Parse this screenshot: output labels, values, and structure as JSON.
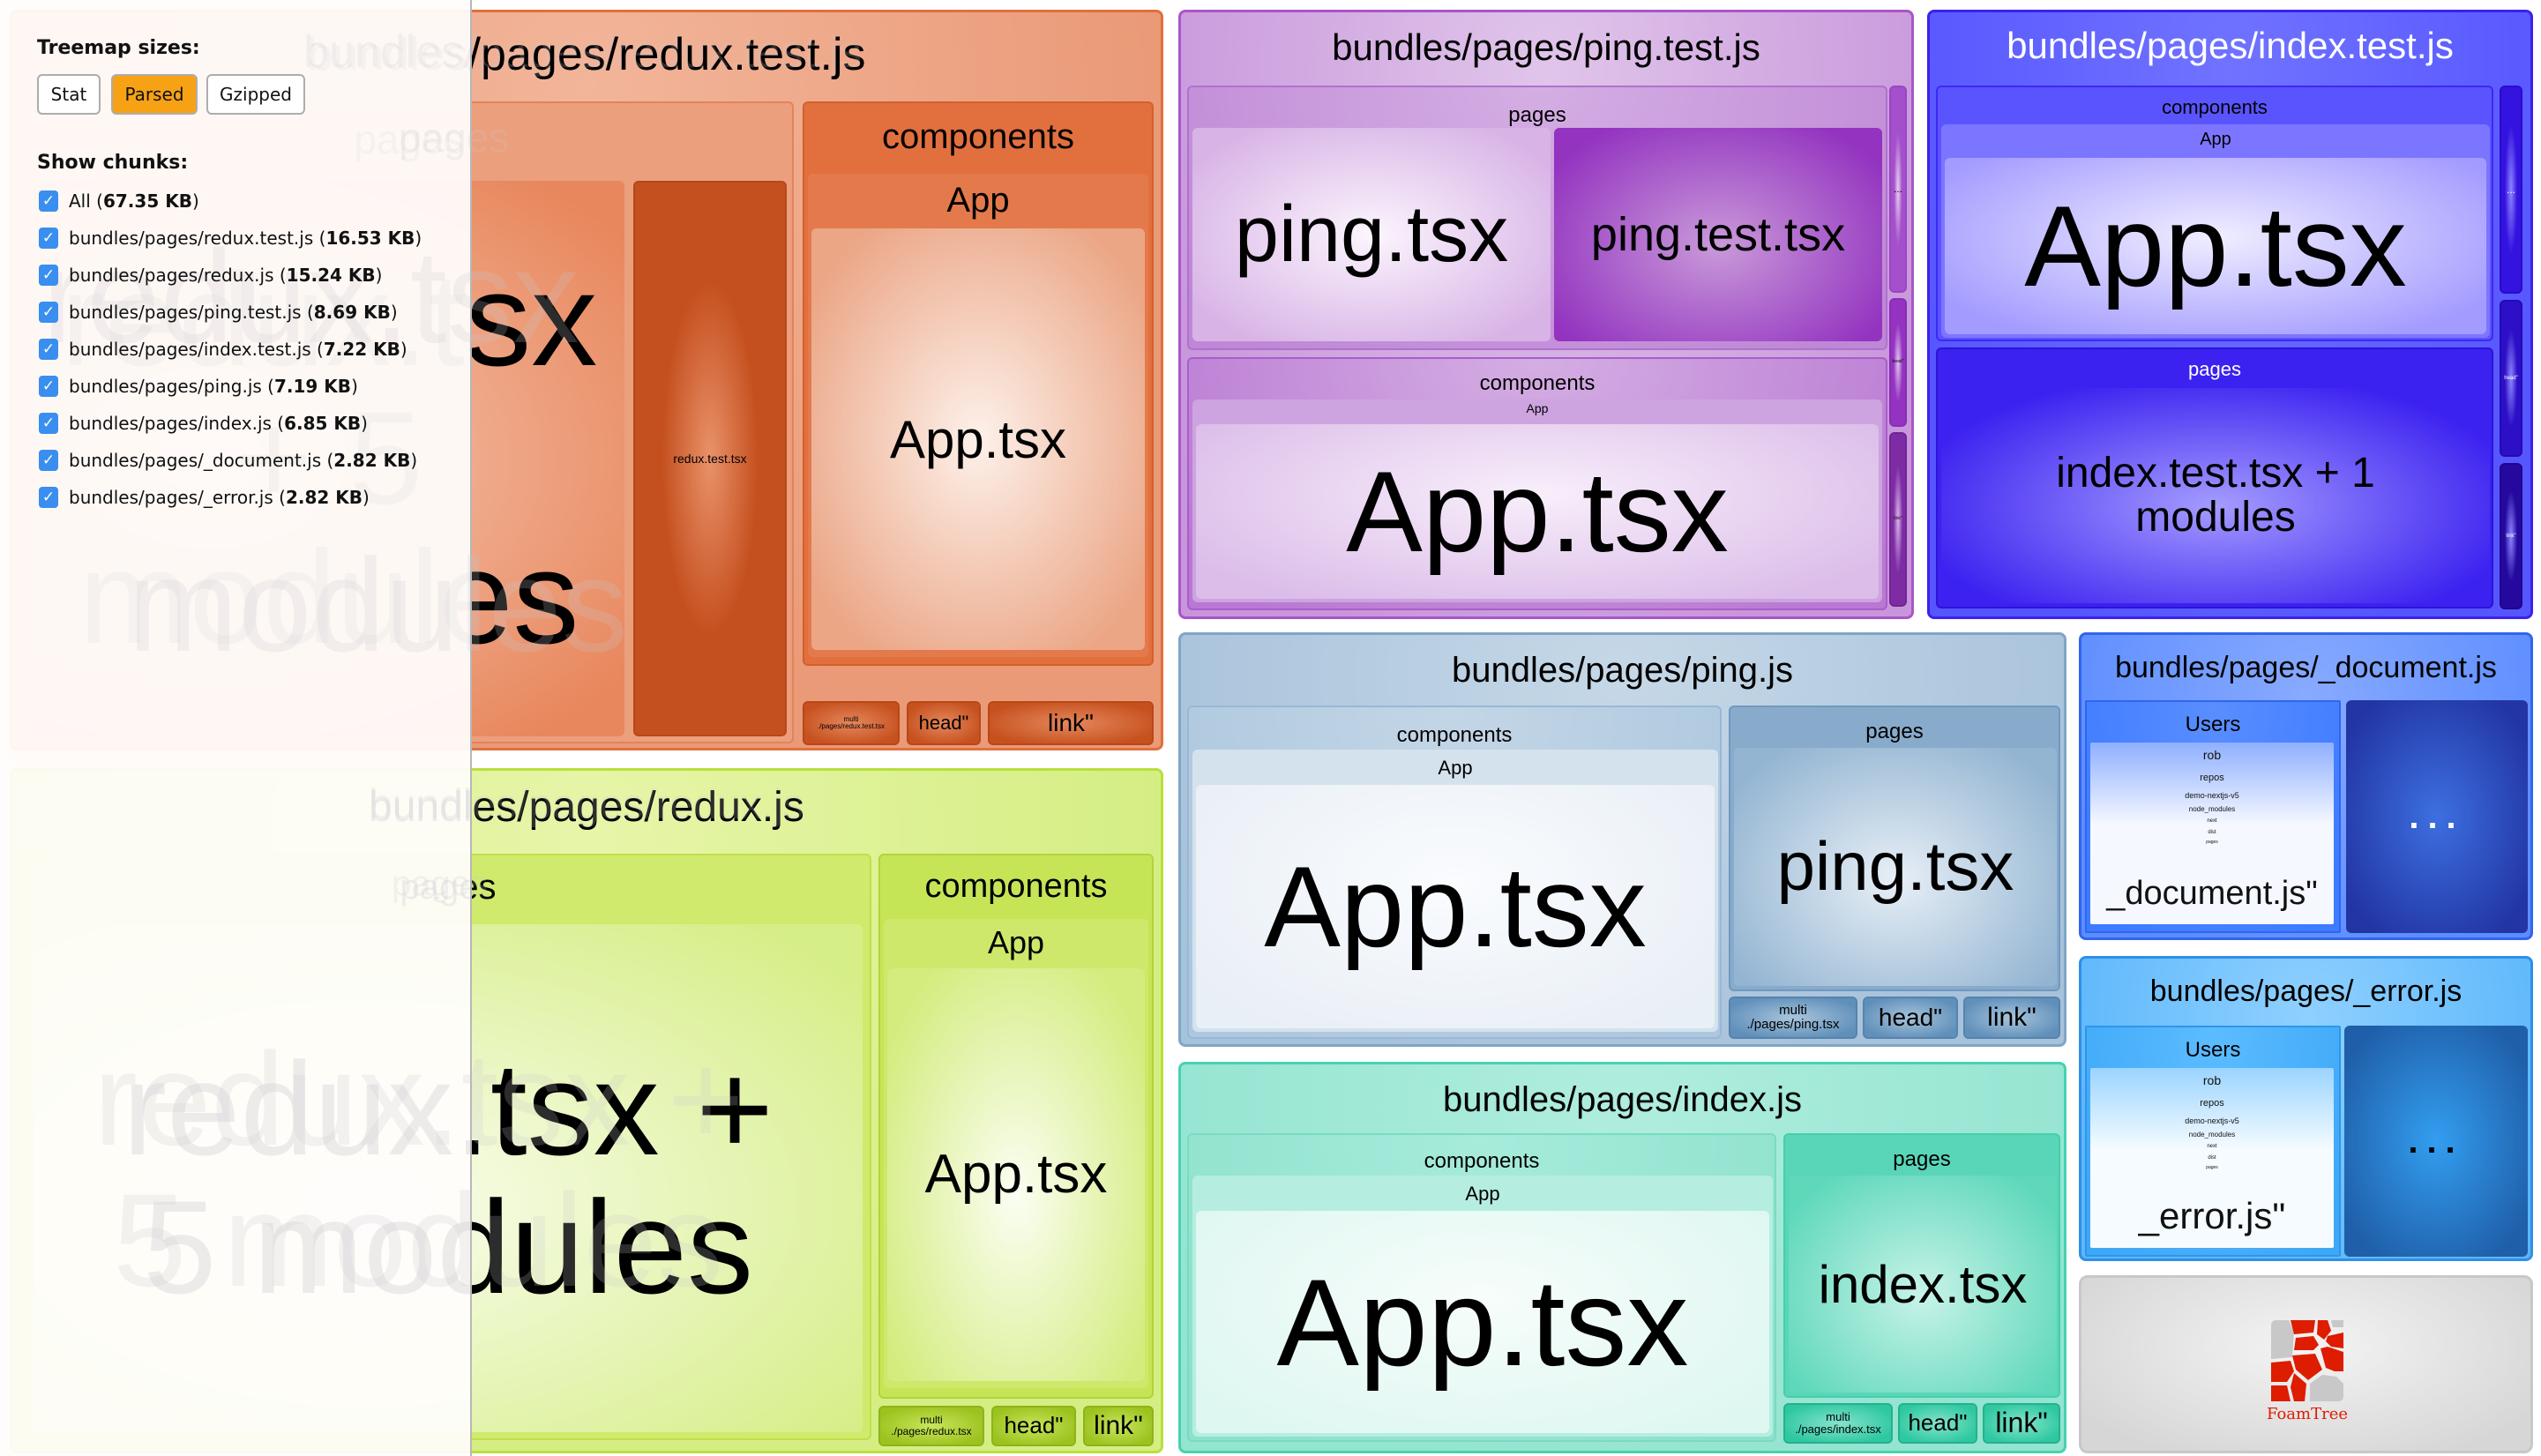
{
  "sidebar": {
    "treemap_sizes_label": "Treemap sizes:",
    "size_options": [
      {
        "label": "Stat",
        "active": false
      },
      {
        "label": "Parsed",
        "active": true
      },
      {
        "label": "Gzipped",
        "active": false
      }
    ],
    "show_chunks_label": "Show chunks:",
    "chunks": [
      {
        "name": "All",
        "size": "67.35 KB",
        "checked": true
      },
      {
        "name": "bundles/pages/redux.test.js",
        "size": "16.53 KB",
        "checked": true
      },
      {
        "name": "bundles/pages/redux.js",
        "size": "15.24 KB",
        "checked": true
      },
      {
        "name": "bundles/pages/ping.test.js",
        "size": "8.69 KB",
        "checked": true
      },
      {
        "name": "bundles/pages/index.test.js",
        "size": "7.22 KB",
        "checked": true
      },
      {
        "name": "bundles/pages/ping.js",
        "size": "7.19 KB",
        "checked": true
      },
      {
        "name": "bundles/pages/index.js",
        "size": "6.85 KB",
        "checked": true
      },
      {
        "name": "bundles/pages/_document.js",
        "size": "2.82 KB",
        "checked": true
      },
      {
        "name": "bundles/pages/_error.js",
        "size": "2.82 KB",
        "checked": true
      }
    ],
    "active_button_color": "#f7a215",
    "checkbox_color": "#3a8ef0"
  },
  "treemap": {
    "redux_test": {
      "title": "bundles/pages/redux.test.js",
      "pages_label": "pages",
      "main_line1": "redux.tsx",
      "main_line2": "+ 5",
      "main_line3": "modules",
      "dark_cell": "redux.test.tsx",
      "components_label": "components",
      "app_label": "App",
      "app_tsx": "App.tsx",
      "multi_line1": "multi",
      "multi_line2": "./pages/redux.test.tsx",
      "head": "head\"",
      "link": "link\"",
      "color": "#e0703e"
    },
    "redux": {
      "title": "bundles/pages/redux.js",
      "pages_label": "pages",
      "main_line1": "redux.tsx +",
      "main_line2": "5 modules",
      "components_label": "components",
      "app_label": "App",
      "app_tsx": "App.tsx",
      "multi_line1": "multi",
      "multi_line2": "./pages/redux.tsx",
      "head": "head\"",
      "link": "link\"",
      "color": "#b8e03b"
    },
    "ping_test": {
      "title": "bundles/pages/ping.test.js",
      "pages_label": "pages",
      "ping_tsx": "ping.tsx",
      "ping_test_tsx": "ping.test.tsx",
      "components_label": "components",
      "app_label": "App",
      "app_tsx": "App.tsx",
      "side_more": "...",
      "side_head": "head\"",
      "side_link": "link\"",
      "color": "#a955c9"
    },
    "index_test": {
      "title": "bundles/pages/index.test.js",
      "components_label": "components",
      "app_label": "App",
      "app_tsx": "App.tsx",
      "pages_label": "pages",
      "index_test_line1": "index.test.tsx + 1",
      "index_test_line2": "modules",
      "side_more": "...",
      "side_head": "head\"",
      "side_link": "link\"",
      "color": "#3a22ee"
    },
    "ping": {
      "title": "bundles/pages/ping.js",
      "components_label": "components",
      "app_label": "App",
      "app_tsx": "App.tsx",
      "pages_label": "pages",
      "ping_tsx": "ping.tsx",
      "multi_line1": "multi",
      "multi_line2": "./pages/ping.tsx",
      "head": "head\"",
      "link": "link\"",
      "color": "#7fa5c7"
    },
    "index": {
      "title": "bundles/pages/index.js",
      "components_label": "components",
      "app_label": "App",
      "app_tsx": "App.tsx",
      "pages_label": "pages",
      "index_tsx": "index.tsx",
      "multi_line1": "multi",
      "multi_line2": "./pages/index.tsx",
      "head": "head\"",
      "link": "link\"",
      "color": "#48d2b0"
    },
    "document": {
      "title": "bundles/pages/_document.js",
      "users_label": "Users",
      "tree": [
        "rob",
        "repos",
        "demo-nextjs-v5",
        "node_modules",
        "next",
        "dist",
        "pages"
      ],
      "file": "_document.js\"",
      "more": "...",
      "color": "#3065ee"
    },
    "error": {
      "title": "bundles/pages/_error.js",
      "users_label": "Users",
      "tree": [
        "rob",
        "repos",
        "demo-nextjs-v5",
        "node_modules",
        "next",
        "dist",
        "pages"
      ],
      "file": "_error.js\"",
      "more": "...",
      "color": "#2f8fe8"
    },
    "foamtree": {
      "logo_text": "FoamTree",
      "logo_color": "#dd1c00"
    }
  }
}
